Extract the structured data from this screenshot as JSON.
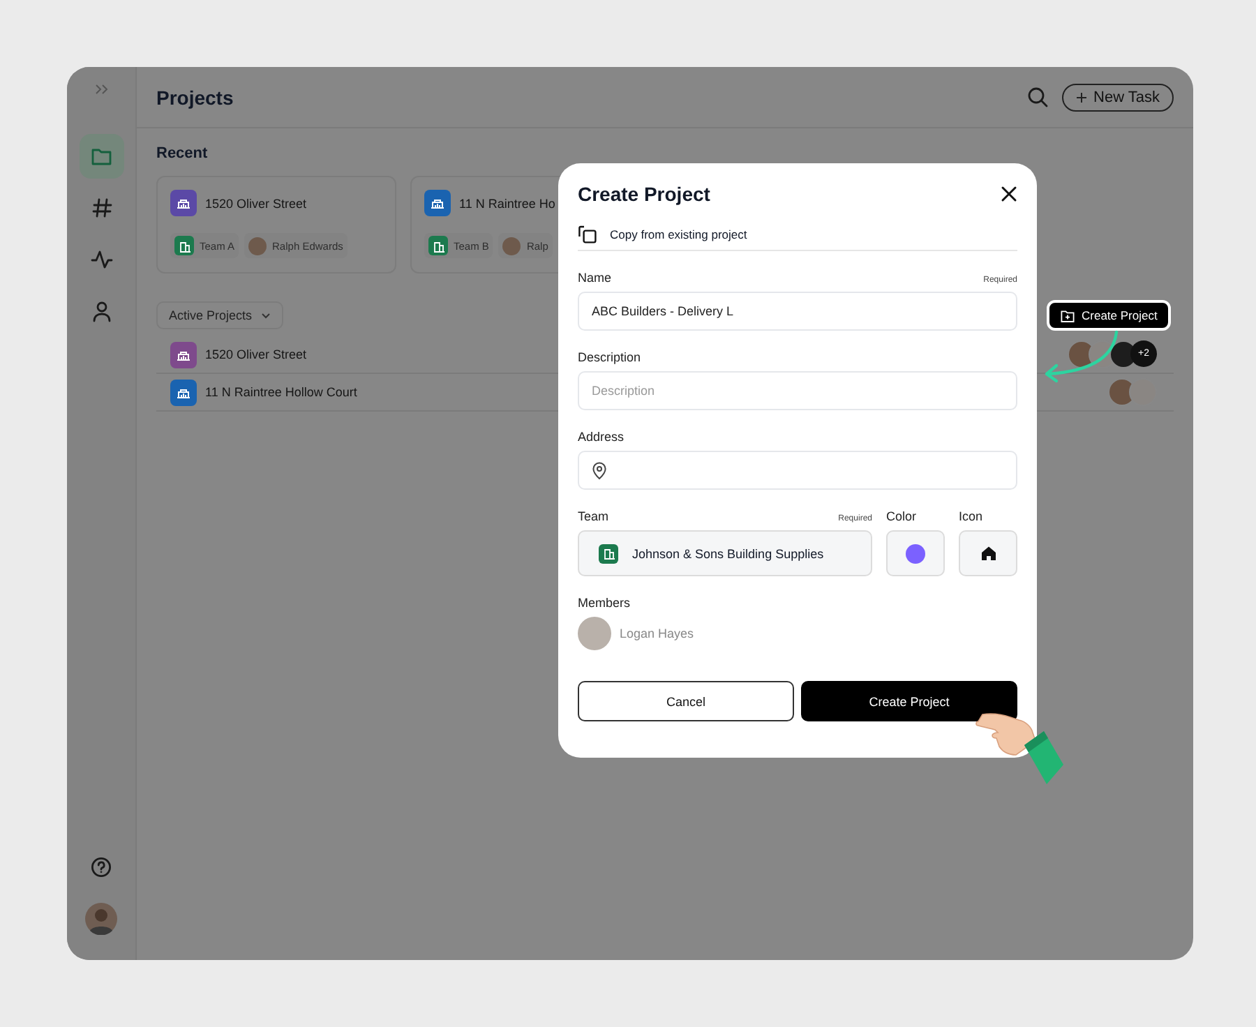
{
  "sidebar": {
    "items": [
      {
        "kind": "folder",
        "selected": true
      },
      {
        "kind": "hash",
        "selected": false
      },
      {
        "kind": "activity",
        "selected": false
      },
      {
        "kind": "person",
        "selected": false
      }
    ]
  },
  "header": {
    "title": "Projects",
    "new_task": "New Task"
  },
  "recent": {
    "title": "Recent",
    "cards": [
      {
        "name": "1520 Oliver Street",
        "color": "#5b49a6",
        "team": "Team A",
        "owner": "Ralph Edwards"
      },
      {
        "name": "11 N Raintree Ho",
        "color": "#1a63b0",
        "team": "Team B",
        "owner": "Ralp"
      }
    ]
  },
  "filter": {
    "label": "Active Projects"
  },
  "projects": [
    {
      "name": "1520 Oliver Street",
      "color": "#7e4a8c",
      "more": "+2"
    },
    {
      "name": "11 N Raintree Hollow Court",
      "color": "#1a63b0"
    }
  ],
  "callout": {
    "label": "Create Project"
  },
  "modal": {
    "title": "Create Project",
    "copy_option": "Copy from existing project",
    "name": {
      "label": "Name",
      "required": "Required",
      "value": "ABC Builders - Delivery L"
    },
    "description": {
      "label": "Description",
      "placeholder": "Description"
    },
    "address": {
      "label": "Address"
    },
    "team": {
      "label": "Team",
      "required": "Required",
      "value": "Johnson & Sons Building Supplies"
    },
    "color": {
      "label": "Color",
      "color": "#7b61ff"
    },
    "icon": {
      "label": "Icon"
    },
    "members": {
      "label": "Members",
      "items": [
        {
          "name": "Logan Hayes"
        }
      ]
    },
    "buttons": {
      "cancel": "Cancel",
      "submit": "Create Project"
    }
  }
}
